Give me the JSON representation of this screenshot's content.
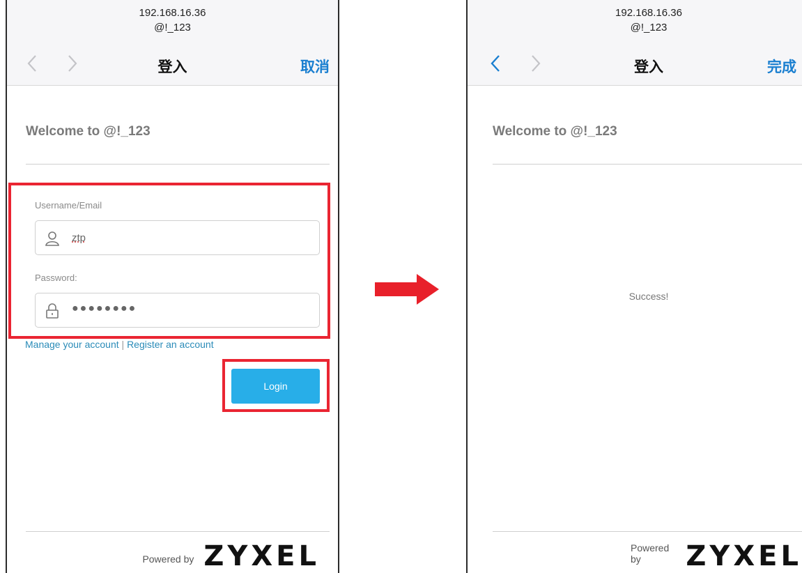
{
  "left_phone": {
    "url_ip": "192.168.16.36",
    "url_ssid": "@!_123",
    "nav_title": "登入",
    "nav_action": "取消",
    "welcome": "Welcome to @!_123",
    "username_label": "Username/Email",
    "username_value": "ztp",
    "password_label": "Password:",
    "password_value": "●●●●●●●●",
    "link_manage": "Manage your account",
    "link_separator": "|",
    "link_register": "Register an account",
    "login_label": "Login",
    "powered_by": "Powered by",
    "brand": "ZYXEL"
  },
  "right_phone": {
    "url_ip": "192.168.16.36",
    "url_ssid": "@!_123",
    "nav_title": "登入",
    "nav_action": "完成",
    "welcome": "Welcome to @!_123",
    "status": "Success!",
    "powered_by": "Powered by",
    "brand": "ZYXEL"
  },
  "colors": {
    "highlight": "#ea2532",
    "arrow": "#e8202a",
    "button": "#28aee8",
    "ios_blue": "#1a7fd0",
    "link": "#2a8bb8"
  },
  "icons": [
    "chevron-left-icon",
    "chevron-right-icon",
    "user-icon",
    "lock-icon",
    "arrow-right-icon"
  ]
}
